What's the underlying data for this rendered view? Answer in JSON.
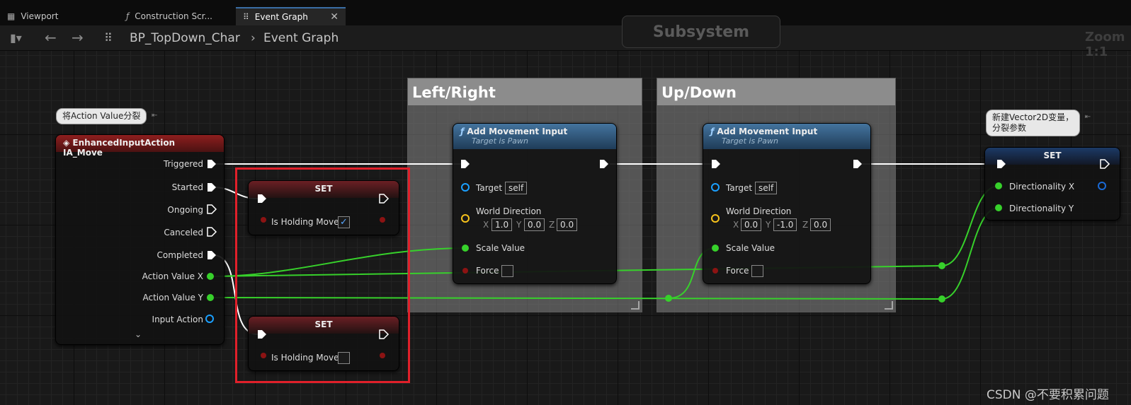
{
  "tabs": [
    {
      "icon": "viewport-icon",
      "label": "Viewport"
    },
    {
      "icon": "function-icon",
      "label": "Construction Scr..."
    },
    {
      "icon": "graph-icon",
      "label": "Event Graph"
    }
  ],
  "breadcrumb": {
    "root": "BP_TopDown_Char",
    "current": "Event Graph"
  },
  "overlay": {
    "subsystem": "Subsystem",
    "zoom": "Zoom 1:1"
  },
  "comments": [
    {
      "title": "Left/Right"
    },
    {
      "title": "Up/Down"
    }
  ],
  "bubbles": {
    "split": "将Action Value分裂",
    "vector_l1": "新建Vector2D变量，",
    "vector_l2": "分裂参数"
  },
  "event_node": {
    "title": "EnhancedInputAction IA_Move",
    "pins": [
      "Triggered",
      "Started",
      "Ongoing",
      "Canceled",
      "Completed",
      "Action Value X",
      "Action Value Y",
      "Input Action"
    ]
  },
  "set_nodes": {
    "set1": {
      "title": "SET",
      "var": "Is Holding Move",
      "checked": true
    },
    "set2": {
      "title": "SET",
      "var": "Is Holding Move",
      "checked": false
    },
    "set3": {
      "title": "SET",
      "pin_x": "Directionality X",
      "pin_y": "Directionality Y"
    }
  },
  "move_nodes": [
    {
      "title": "Add Movement Input",
      "subtitle": "Target is Pawn",
      "target_label": "Target",
      "target_value": "self",
      "dir_label": "World Direction",
      "x": "1.0",
      "y": "0.0",
      "z": "0.0",
      "scale": "Scale Value",
      "force": "Force"
    },
    {
      "title": "Add Movement Input",
      "subtitle": "Target is Pawn",
      "target_label": "Target",
      "target_value": "self",
      "dir_label": "World Direction",
      "x": "0.0",
      "y": "-1.0",
      "z": "0.0",
      "scale": "Scale Value",
      "force": "Force"
    }
  ],
  "axis_labels": {
    "x": "X",
    "y": "Y",
    "z": "Z"
  },
  "watermark": "CSDN @不要积累问题",
  "colors": {
    "exec": "#ffffff",
    "float": "#37d12b",
    "bool": "#8c1313",
    "object": "#1aa0ff",
    "vector": "#f7c21b",
    "highlight": "#e0202a"
  }
}
